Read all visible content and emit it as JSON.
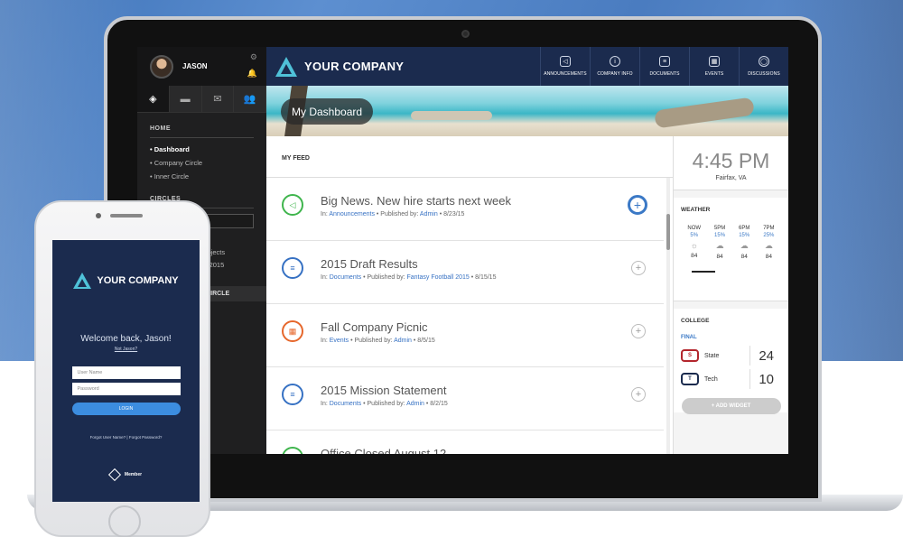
{
  "sidebar": {
    "user_name": "JASON",
    "home_section": "HOME",
    "home_items": [
      "• Dashboard",
      "• Company Circle",
      "• Inner Circle"
    ],
    "circles_section": "CIRCLES",
    "circle_items": [
      "Projects",
      "all 2015"
    ],
    "highlight_item": "L CIRCLE"
  },
  "header": {
    "company_name": "YOUR COMPANY",
    "nav": [
      {
        "label": "ANNOUNCEMENTS",
        "icon": "megaphone-icon"
      },
      {
        "label": "COMPANY INFO",
        "icon": "info-icon"
      },
      {
        "label": "DOCUMENTS",
        "icon": "document-icon"
      },
      {
        "label": "EVENTS",
        "icon": "calendar-icon"
      },
      {
        "label": "DISCUSSIONS",
        "icon": "chat-icon"
      }
    ]
  },
  "banner": {
    "title": "My Dashboard"
  },
  "feed": {
    "heading": "MY FEED",
    "posts": [
      {
        "title": "Big News. New hire starts next week",
        "in_label": "In:",
        "category": "Announcements",
        "published_label": "• Published by:",
        "author": "Admin",
        "date": "• 8/23/15",
        "color": "#3fb54d"
      },
      {
        "title": "2015 Draft Results",
        "in_label": "In:",
        "category": "Documents",
        "published_label": "• Published by:",
        "author": "Fantasy Football 2015",
        "date": "• 8/15/15",
        "color": "#3671c3"
      },
      {
        "title": "Fall Company Picnic",
        "in_label": "In:",
        "category": "Events",
        "published_label": "• Published by:",
        "author": "Admin",
        "date": "• 8/5/15",
        "color": "#e6672c"
      },
      {
        "title": "2015 Mission Statement",
        "in_label": "In:",
        "category": "Documents",
        "published_label": "• Published by:",
        "author": "Admin",
        "date": "• 8/2/15",
        "color": "#3671c3"
      },
      {
        "title": "Office Closed August 12",
        "in_label": "",
        "category": "",
        "published_label": "",
        "author": "",
        "date": "",
        "color": "#3fb54d"
      }
    ]
  },
  "clock": {
    "time": "4:45 PM",
    "location": "Fairfax, VA"
  },
  "weather": {
    "title": "WEATHER",
    "columns": [
      {
        "label": "NOW",
        "pct": "5%",
        "icon": "sun-icon",
        "temp": "84"
      },
      {
        "label": "5PM",
        "pct": "15%",
        "icon": "cloud-icon",
        "temp": "84"
      },
      {
        "label": "6PM",
        "pct": "15%",
        "icon": "cloud-icon",
        "temp": "84"
      },
      {
        "label": "7PM",
        "pct": "25%",
        "icon": "cloud-icon",
        "temp": "84"
      }
    ]
  },
  "college": {
    "title": "COLLEGE",
    "status": "FINAL",
    "teams": [
      {
        "name": "State",
        "score": "24",
        "color": "#b3262d"
      },
      {
        "name": "Tech",
        "score": "10",
        "color": "#1b2b4e"
      }
    ]
  },
  "add_widget": "+ ADD WIDGET",
  "phone": {
    "company_name": "YOUR COMPANY",
    "welcome": "Welcome back, Jason!",
    "not_you": "Not Jason?",
    "username_placeholder": "User Name",
    "password_placeholder": "Password",
    "login": "LOGIN",
    "forgot": "Forgot User Name? | Forgot Password?",
    "footer_brand": "Member"
  }
}
